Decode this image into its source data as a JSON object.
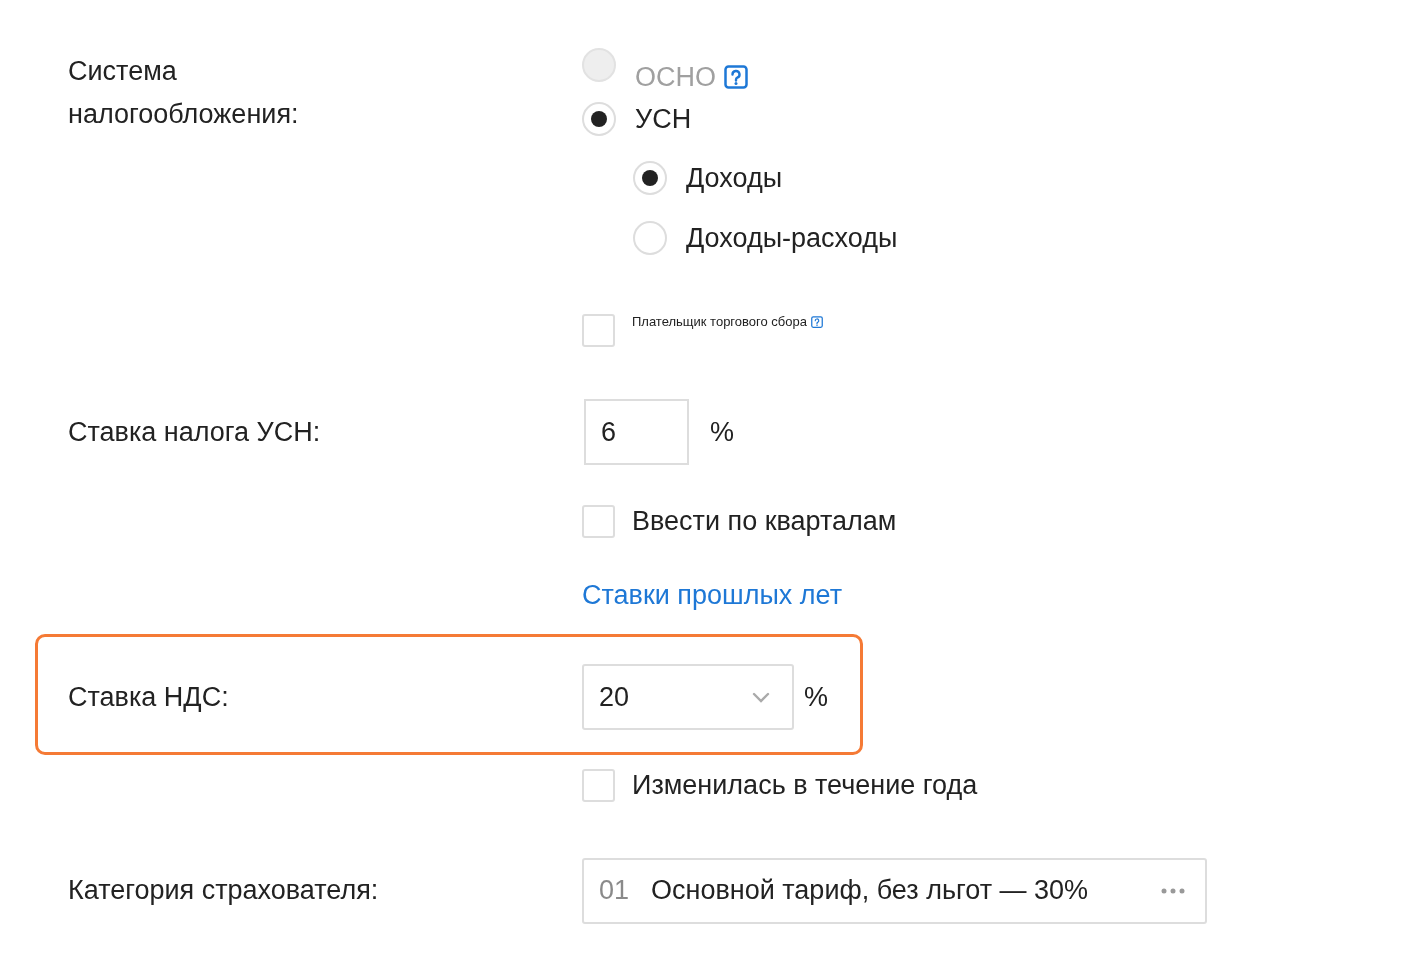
{
  "tax_system": {
    "label": "Система налогообложения:",
    "options": [
      {
        "label": "ОСНО",
        "selected": false,
        "disabled": true,
        "help": true
      },
      {
        "label": "УСН",
        "selected": true,
        "disabled": false,
        "help": false,
        "children": [
          {
            "label": "Доходы",
            "selected": true
          },
          {
            "label": "Доходы-расходы",
            "selected": false
          }
        ]
      }
    ],
    "trade_fee": {
      "label": "Плательщик торгового сбора",
      "checked": false,
      "help": true
    }
  },
  "usn_rate": {
    "label": "Ставка налога УСН:",
    "value": "6",
    "unit": "%",
    "by_quarters": {
      "label": "Ввести по кварталам",
      "checked": false
    },
    "link": "Ставки прошлых лет"
  },
  "vat": {
    "label": "Ставка НДС:",
    "value": "20",
    "unit": "%",
    "highlighted": true,
    "changed_during_year": {
      "label": "Изменилась в течение года",
      "checked": false
    }
  },
  "insurer_category": {
    "label": "Категория страхователя:",
    "code": "01",
    "value": "Основной тариф, без льгот — 30%"
  }
}
